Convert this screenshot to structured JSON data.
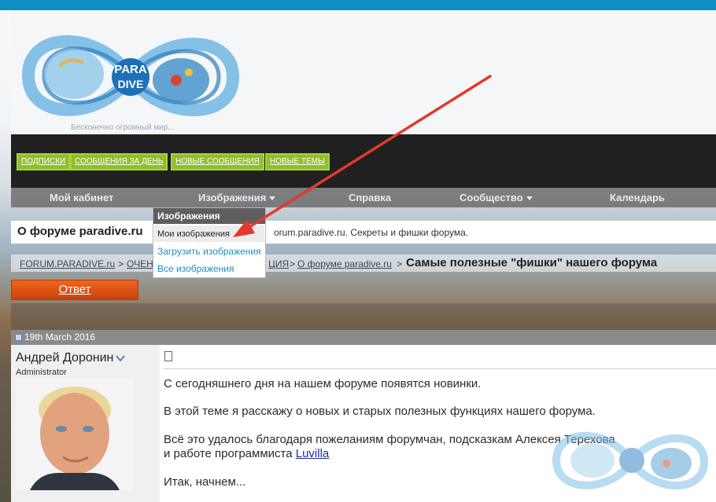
{
  "header": {
    "logo_text_top": "PARA",
    "logo_text_bottom": "DIVE",
    "tagline": "Бесконечно огромный мир..."
  },
  "quick_links": [
    {
      "label": "ПОДПИСКИ"
    },
    {
      "label": "СООБЩЕНИЯ ЗА ДЕНЬ"
    },
    {
      "label": "НОВЫЕ СООБЩЕНИЯ"
    },
    {
      "label": "НОВЫЕ ТЕМЫ"
    }
  ],
  "menu": {
    "cabinet": "Мой кабинет",
    "images": "Изображения",
    "help": "Справка",
    "community": "Сообщество",
    "calendar": "Календарь"
  },
  "dropdown": {
    "title": "Изображения",
    "items": [
      {
        "label": "Мои изображения"
      },
      {
        "label": "Загрузить изображения"
      },
      {
        "label": "Все изображения"
      }
    ]
  },
  "forum": {
    "title": "О форуме paradive.ru",
    "description": "orum.paradive.ru. Секреты и фишки форума."
  },
  "breadcrumb": {
    "home": "FORUM.PARADIVE.ru",
    "section_start": "ОЧЕН",
    "section_end": "ЦИЯ",
    "forum": "О форуме paradive.ru",
    "separator": ">",
    "current": "Самые полезные \"фишки\" нашего форума"
  },
  "actions": {
    "reply_label": "Ответ"
  },
  "post": {
    "date": "19th March 2016",
    "author": "Андрей Доронин",
    "role": "Administrator",
    "line1": "С сегодняшнего дня на нашем форуме появятся новинки.",
    "line2": "В этой теме я расскажу о новых и старых полезных функциях нашего форума.",
    "line3": "Всё это удалось благодаря пожеланиям форумчан, подсказкам Алексея Терехова",
    "line4_prefix": "и работе программиста ",
    "line4_link": "Luvilla",
    "line5": "Итак, начнем..."
  },
  "colors": {
    "top_bar": "#0d8fc6",
    "quick_link_green": "#8fbf2a",
    "reply_orange": "#e4561a",
    "link_teal": "#1f8fbf",
    "annotation_arrow": "#e03a2c"
  },
  "icons": {
    "dropdown_caret": "caret-down-icon",
    "post_doc": "document-icon",
    "user_menu": "chevron-down-icon",
    "date_marker": "calendar-icon"
  }
}
